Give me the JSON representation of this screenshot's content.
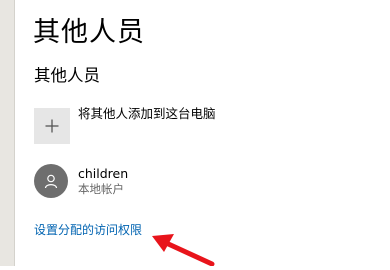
{
  "page": {
    "title": "其他人员"
  },
  "section": {
    "title": "其他人员",
    "add_label": "将其他人添加到这台电脑",
    "add_icon": "plus-icon"
  },
  "user": {
    "name": "children",
    "type": "本地帐户",
    "avatar_icon": "person-icon"
  },
  "link": {
    "label": "设置分配的访问权限"
  },
  "colors": {
    "link": "#0063b1",
    "annotation_arrow": "#e8141b",
    "avatar": "#6e6e6e",
    "tile": "#e6e6e6"
  }
}
